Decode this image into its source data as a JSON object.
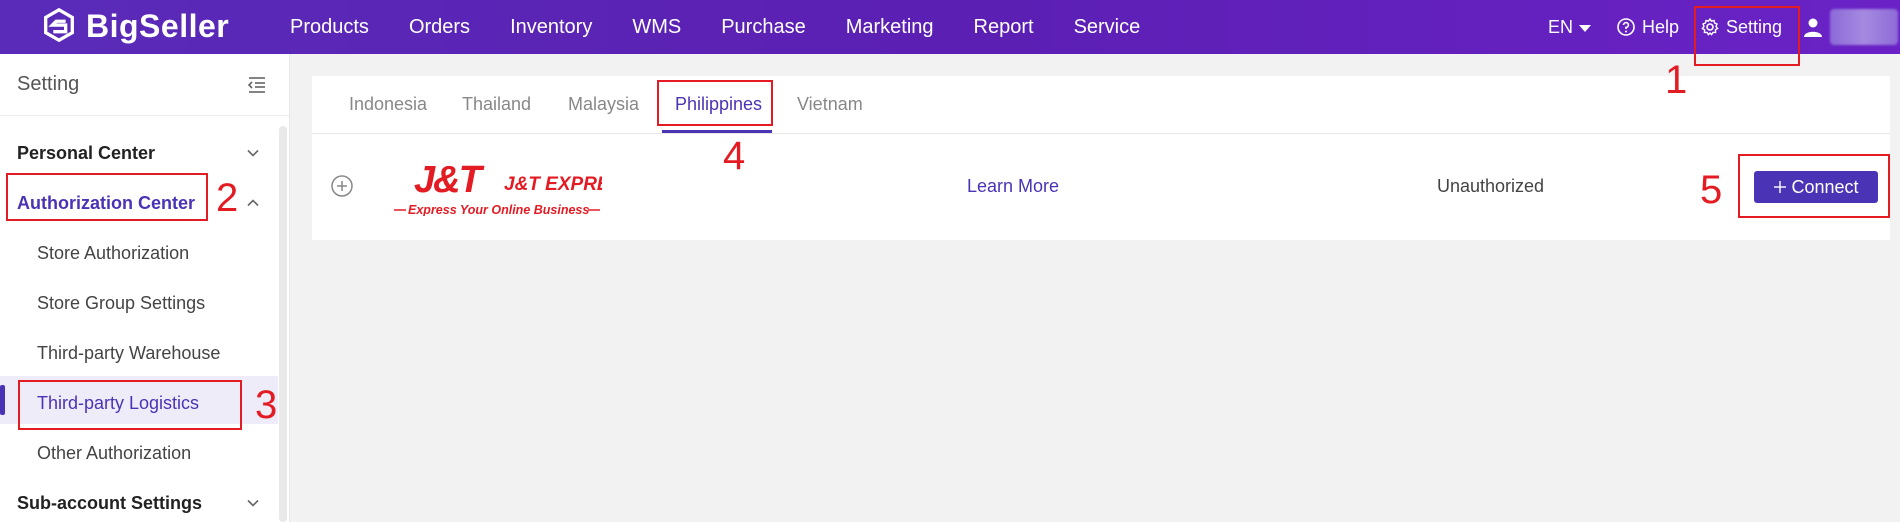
{
  "brand": {
    "name": "BigSeller"
  },
  "nav": {
    "items": [
      "Products",
      "Orders",
      "Inventory",
      "WMS",
      "Purchase",
      "Marketing",
      "Report",
      "Service"
    ],
    "language": "EN",
    "help": "Help",
    "setting": "Setting"
  },
  "sidebar": {
    "title": "Setting",
    "groups": {
      "personal": "Personal Center",
      "authorization": "Authorization Center",
      "subaccount": "Sub-account Settings"
    },
    "items": [
      "Store Authorization",
      "Store Group Settings",
      "Third-party Warehouse",
      "Third-party Logistics",
      "Other Authorization"
    ]
  },
  "tabs": [
    "Indonesia",
    "Thailand",
    "Malaysia",
    "Philippines",
    "Vietnam"
  ],
  "active_tab": "Philippines",
  "logistics_row": {
    "logo_text": "J&T EXPRESS",
    "logo_tagline": "Express Your Online Business",
    "learn_more": "Learn More",
    "status": "Unauthorized",
    "connect": "Connect"
  },
  "annotations": [
    "1",
    "2",
    "3",
    "4",
    "5"
  ],
  "colors": {
    "accent": "#4b33b5",
    "topbar": "#5b1fb3",
    "annotation": "#e31b23",
    "jt_red": "#e31b23"
  }
}
